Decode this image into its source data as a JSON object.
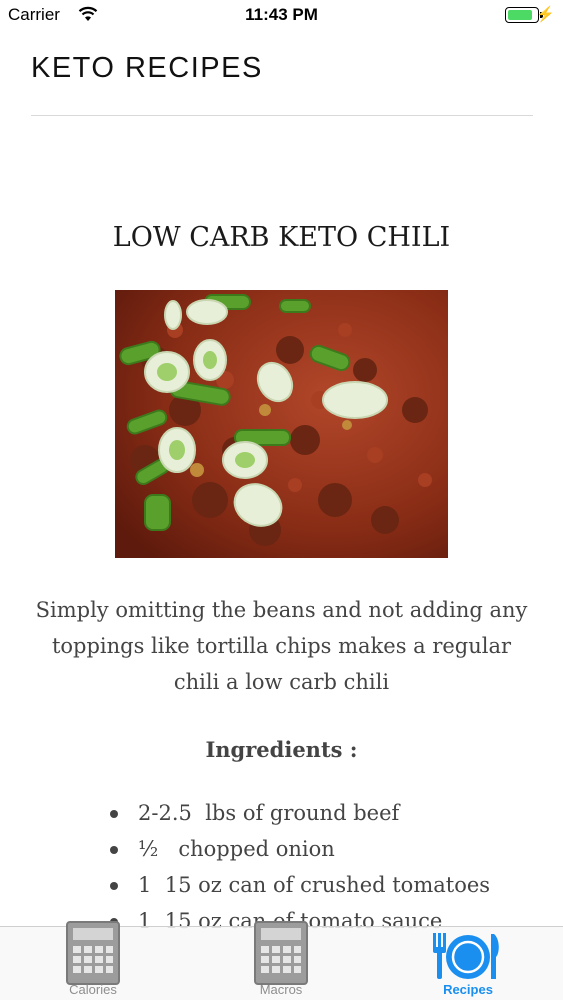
{
  "status": {
    "carrier": "Carrier",
    "time": "11:43 PM",
    "battery_level": 0.9
  },
  "header": {
    "title": "KETO RECIPES"
  },
  "recipe": {
    "title": "LOW CARB KETO CHILI",
    "description": "Simply omitting the beans and not adding any toppings like tortilla chips makes a regular chili a low carb chili",
    "ingredients_heading": "Ingredients :",
    "ingredients": [
      "2-2.5  lbs of ground beef",
      "½   chopped onion",
      "1  15 oz can of crushed tomatoes",
      "1  15 oz can of tomato sauce"
    ]
  },
  "tabs": [
    {
      "label": "Calories",
      "icon": "calculator-icon",
      "active": false
    },
    {
      "label": "Macros",
      "icon": "calculator-icon",
      "active": false
    },
    {
      "label": "Recipes",
      "icon": "plate-cutlery-icon",
      "active": true
    }
  ],
  "colors": {
    "accent": "#1a8ff0",
    "battery": "#4cd964",
    "inactive_tab": "#8e8e8e"
  }
}
